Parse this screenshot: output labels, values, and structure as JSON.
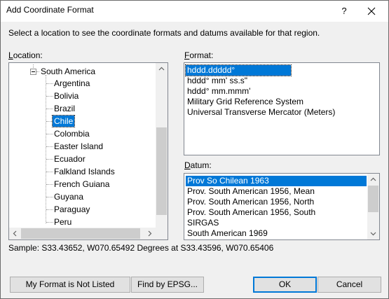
{
  "window": {
    "title": "Add Coordinate Format",
    "help_glyph": "?"
  },
  "instructions": "Select a location to see the coordinate formats and datums available for that region.",
  "location": {
    "label_hotkey": "L",
    "label_rest": "ocation:",
    "parent": "South America",
    "children": [
      "Argentina",
      "Bolivia",
      "Brazil",
      "Chile",
      "Colombia",
      "Easter Island",
      "Ecuador",
      "Falkland Islands",
      "French Guiana",
      "Guyana",
      "Paraguay",
      "Peru"
    ],
    "selected": "Chile"
  },
  "format": {
    "label_hotkey": "F",
    "label_rest": "ormat:",
    "items": [
      "hddd.ddddd°",
      "hddd° mm' ss.s\"",
      "hddd° mm.mmm'",
      "Military Grid Reference System",
      "Universal Transverse Mercator (Meters)"
    ],
    "selected": "hddd.ddddd°"
  },
  "datum": {
    "label_hotkey": "D",
    "label_rest": "atum:",
    "items": [
      "Prov So Chilean 1963",
      "Prov. South American 1956, Mean",
      "Prov. South American 1956, North",
      "Prov. South American 1956, South",
      "SIRGAS",
      "South American 1969"
    ],
    "selected": "Prov So Chilean 1963"
  },
  "sample": "Sample: S33.43652, W070.65492 Degrees at S33.43596, W070.65406",
  "buttons": {
    "not_listed": "My Format is Not Listed",
    "find_epsg": "Find by EPSG...",
    "ok": "OK",
    "cancel": "Cancel"
  },
  "colors": {
    "selection": "#0078d7",
    "border": "#828790"
  }
}
